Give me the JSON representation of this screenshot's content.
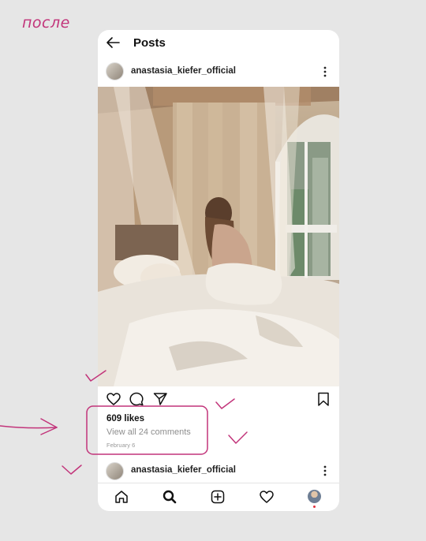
{
  "annotation": {
    "text": "после",
    "color": "#c2347a"
  },
  "topbar": {
    "title": "Posts",
    "back_icon": "arrow-left-icon"
  },
  "post": {
    "username": "anastasia_kiefer_official",
    "likes": "609 likes",
    "comments_link": "View all 24 comments",
    "date": "February 6"
  },
  "next_post": {
    "username": "anastasia_kiefer_official"
  },
  "actions": [
    "heart-icon",
    "comment-icon",
    "share-icon",
    "bookmark-icon"
  ],
  "bottom_nav": [
    "home-icon",
    "search-icon",
    "add-post-icon",
    "activity-heart-icon",
    "profile-avatar"
  ]
}
